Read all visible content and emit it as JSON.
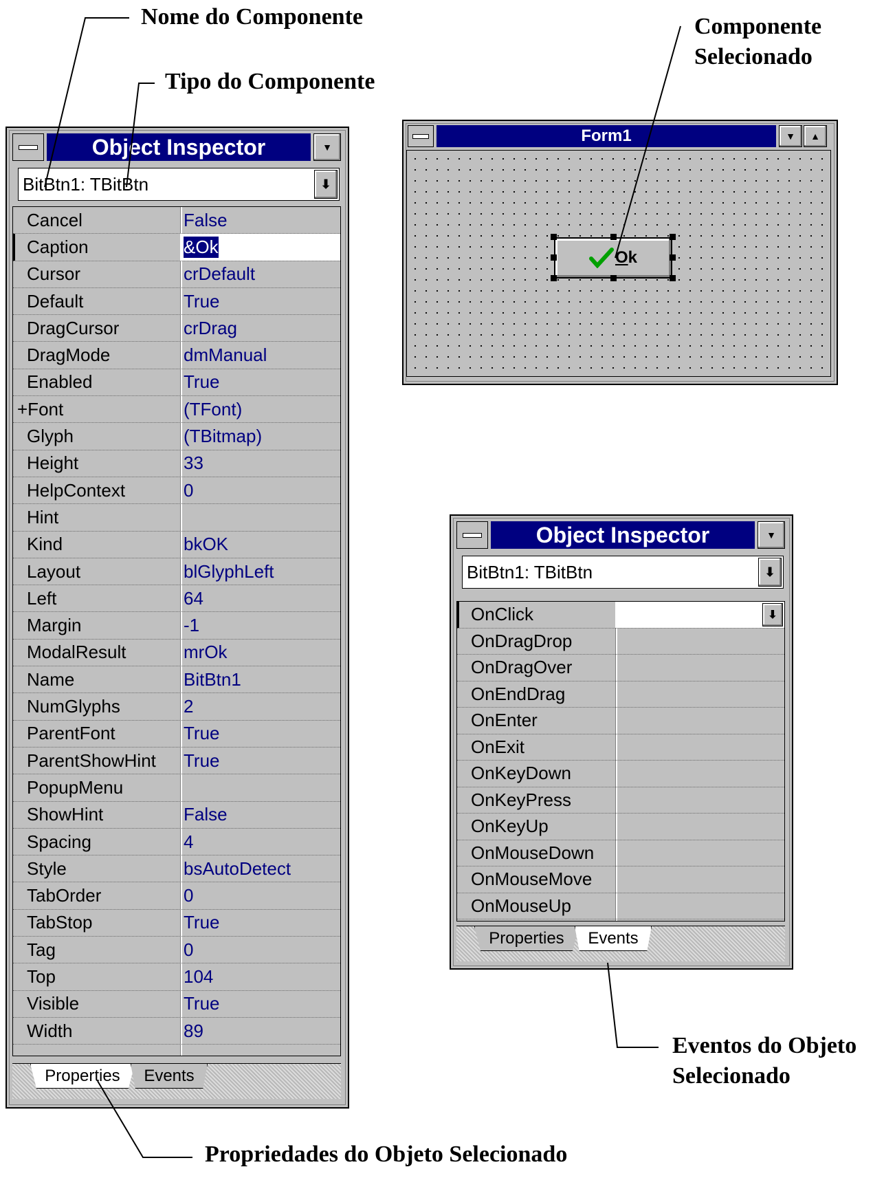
{
  "callouts": {
    "component_name": "Nome do Componente",
    "component_type": "Tipo do Componente",
    "selected_component_1": "Componente",
    "selected_component_2": "Selecionado",
    "object_events_1": "Eventos do Objeto",
    "object_events_2": "Selecionado",
    "selected_object_properties": "Propriedades do Objeto Selecionado"
  },
  "inspector_properties": {
    "title": "Object Inspector",
    "object_selector": "BitBtn1: TBitBtn",
    "selected_row": "Caption",
    "rows": [
      {
        "name": "Cancel",
        "value": "False"
      },
      {
        "name": "Caption",
        "value": "&Ok"
      },
      {
        "name": "Cursor",
        "value": "crDefault"
      },
      {
        "name": "Default",
        "value": "True"
      },
      {
        "name": "DragCursor",
        "value": "crDrag"
      },
      {
        "name": "DragMode",
        "value": "dmManual"
      },
      {
        "name": "Enabled",
        "value": "True"
      },
      {
        "name": "+Font",
        "value": "(TFont)"
      },
      {
        "name": "Glyph",
        "value": "(TBitmap)"
      },
      {
        "name": "Height",
        "value": "33"
      },
      {
        "name": "HelpContext",
        "value": "0"
      },
      {
        "name": "Hint",
        "value": ""
      },
      {
        "name": "Kind",
        "value": "bkOK"
      },
      {
        "name": "Layout",
        "value": "blGlyphLeft"
      },
      {
        "name": "Left",
        "value": "64"
      },
      {
        "name": "Margin",
        "value": "-1"
      },
      {
        "name": "ModalResult",
        "value": "mrOk"
      },
      {
        "name": "Name",
        "value": "BitBtn1"
      },
      {
        "name": "NumGlyphs",
        "value": "2"
      },
      {
        "name": "ParentFont",
        "value": "True"
      },
      {
        "name": "ParentShowHint",
        "value": "True"
      },
      {
        "name": "PopupMenu",
        "value": ""
      },
      {
        "name": "ShowHint",
        "value": "False"
      },
      {
        "name": "Spacing",
        "value": "4"
      },
      {
        "name": "Style",
        "value": "bsAutoDetect"
      },
      {
        "name": "TabOrder",
        "value": "0"
      },
      {
        "name": "TabStop",
        "value": "True"
      },
      {
        "name": "Tag",
        "value": "0"
      },
      {
        "name": "Top",
        "value": "104"
      },
      {
        "name": "Visible",
        "value": "True"
      },
      {
        "name": "Width",
        "value": "89"
      }
    ],
    "tabs": {
      "properties": "Properties",
      "events": "Events"
    },
    "active_tab": "Properties"
  },
  "inspector_events": {
    "title": "Object Inspector",
    "object_selector": "BitBtn1: TBitBtn",
    "selected_row": "OnClick",
    "rows": [
      {
        "name": "OnClick",
        "value": ""
      },
      {
        "name": "OnDragDrop",
        "value": ""
      },
      {
        "name": "OnDragOver",
        "value": ""
      },
      {
        "name": "OnEndDrag",
        "value": ""
      },
      {
        "name": "OnEnter",
        "value": ""
      },
      {
        "name": "OnExit",
        "value": ""
      },
      {
        "name": "OnKeyDown",
        "value": ""
      },
      {
        "name": "OnKeyPress",
        "value": ""
      },
      {
        "name": "OnKeyUp",
        "value": ""
      },
      {
        "name": "OnMouseDown",
        "value": ""
      },
      {
        "name": "OnMouseMove",
        "value": ""
      },
      {
        "name": "OnMouseUp",
        "value": ""
      }
    ],
    "tabs": {
      "properties": "Properties",
      "events": "Events"
    },
    "active_tab": "Events"
  },
  "form": {
    "title": "Form1",
    "button_label": "Ok",
    "button_glyph": "check-icon"
  },
  "colors": {
    "titlebar": "#000080",
    "window_face": "#c0c0c0",
    "value_text": "#000080",
    "check_green": "#00a000"
  }
}
